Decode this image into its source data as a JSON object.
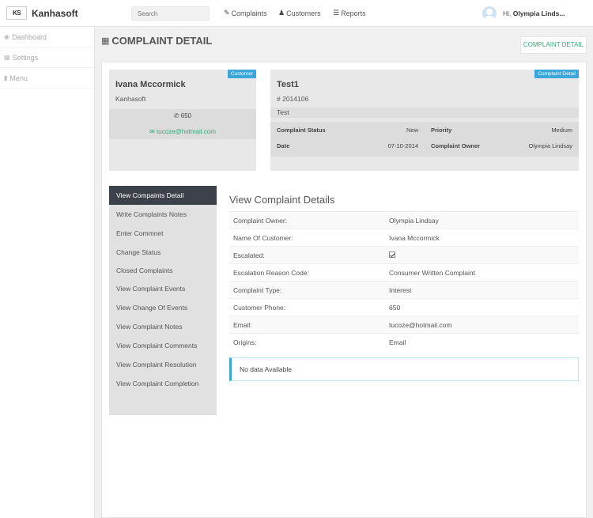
{
  "app": {
    "brand": "Kanhasoft",
    "logo_text": "KS"
  },
  "topbar": {
    "search_placeholder": "Search",
    "nav": [
      {
        "label": "Complaints",
        "icon": "pencil-icon"
      },
      {
        "label": "Customers",
        "icon": "users-icon"
      },
      {
        "label": "Reports",
        "icon": "list-icon"
      }
    ],
    "user_greeting": "Hi,",
    "user_name": "Olympia Linds..."
  },
  "sidebar": {
    "items": [
      {
        "label": "Dashboard",
        "icon": "dashboard-icon"
      },
      {
        "label": "Settings",
        "icon": "grid-icon"
      },
      {
        "label": "Menu",
        "icon": "menu-icon"
      }
    ]
  },
  "page": {
    "title": "COMPLAINT DETAIL",
    "detail_button": "COMPLAINT DETAIL"
  },
  "customer_card": {
    "badge": "Customer",
    "name": "Ivana Mccormick",
    "company": "Kanhasoft",
    "phone": "650",
    "email": "tucoze@hotmail.com"
  },
  "complaint_card": {
    "badge": "Complaint Detail",
    "title": "Test1",
    "number": "# 2014106",
    "description": "Test",
    "status_label": "Complaint Status",
    "status_value": "New",
    "priority_label": "Priority",
    "priority_value": "Medium",
    "date_label": "Date",
    "date_value": "07-10-2014",
    "owner_label": "Complaint Owner",
    "owner_value": "Olympia Lindsay"
  },
  "menu": {
    "items": [
      "View Compaints Detail",
      "Write Complaints Notes",
      "Enter Commnet",
      "Change Status",
      "Closed Complaints",
      "View Complaint Events",
      "View Change Of Events",
      "View Complaint Notes",
      "View Complaint Comments",
      "View Complaint Resolution",
      "View Complaint Completion"
    ],
    "active_index": 0
  },
  "details": {
    "title": "View Complaint Details",
    "rows": [
      {
        "label": "Complaint Owner:",
        "value": "Olympia Lindsay"
      },
      {
        "label": "Name Of Customer:",
        "value": "Ivana Mccormick"
      },
      {
        "label": "Escalated:",
        "value": "",
        "checked": true
      },
      {
        "label": "Escalation Reason Code:",
        "value": "Consumer Written Complaint"
      },
      {
        "label": "Complaint Type:",
        "value": "Interest"
      },
      {
        "label": "Customer Phone:",
        "value": "650"
      },
      {
        "label": "Email:",
        "value": "tucoze@hotmail.com"
      },
      {
        "label": "Origins:",
        "value": "Email"
      }
    ],
    "no_data": "No data Available"
  }
}
